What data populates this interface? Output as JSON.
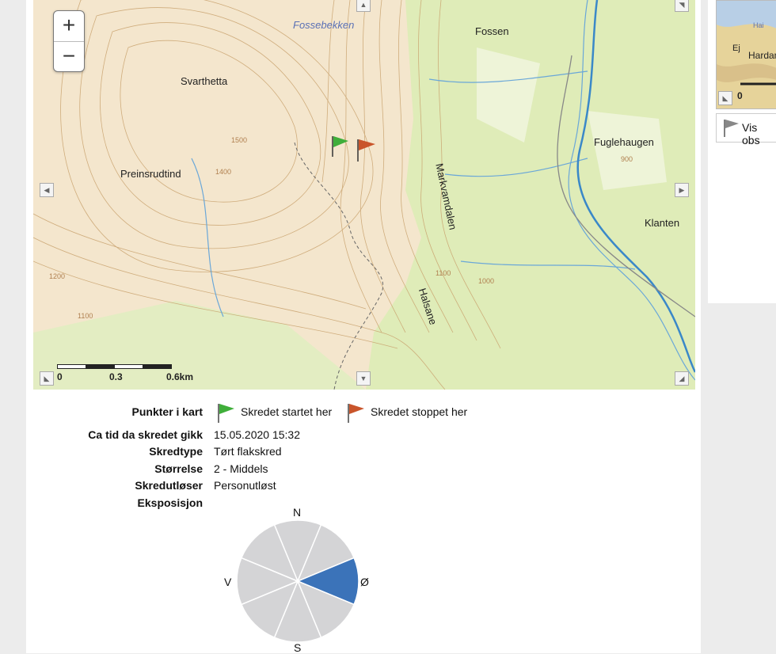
{
  "map": {
    "zoom_in": "+",
    "zoom_out": "−",
    "labels": [
      "Fossebekken",
      "Fossen",
      "Svarthetta",
      "Preinsrudtind",
      "Markvamdalen",
      "Fuglehaugen",
      "Klanten",
      "Halsane"
    ],
    "contours": [
      "1500",
      "1400",
      "1200",
      "1100",
      "1100",
      "1000",
      "900"
    ],
    "scale": [
      "0",
      "0.3",
      "0.6km"
    ]
  },
  "minimap": {
    "labels": [
      "Hardang",
      "Ej",
      "0",
      "Hai"
    ]
  },
  "vis_obs": "Vis obs",
  "details": {
    "punkter_label": "Punkter i kart",
    "start_flag": "Skredet startet her",
    "stop_flag": "Skredet stoppet her",
    "tid_label": "Ca tid da skredet gikk",
    "tid_value": "15.05.2020 15:32",
    "type_label": "Skredtype",
    "type_value": "Tørt flakskred",
    "size_label": "Størrelse",
    "size_value": "2 - Middels",
    "trigger_label": "Skredutløser",
    "trigger_value": "Personutløst",
    "exposure_label": "Eksposisjon"
  },
  "exposure": {
    "directions": [
      "N",
      "Ø",
      "S",
      "V"
    ],
    "highlighted_sector": "Ø",
    "highlight_color": "#3b73b9",
    "base_color": "#d4d4d6"
  },
  "colors": {
    "start_flag": "#3fae3a",
    "stop_flag": "#c9552b"
  }
}
